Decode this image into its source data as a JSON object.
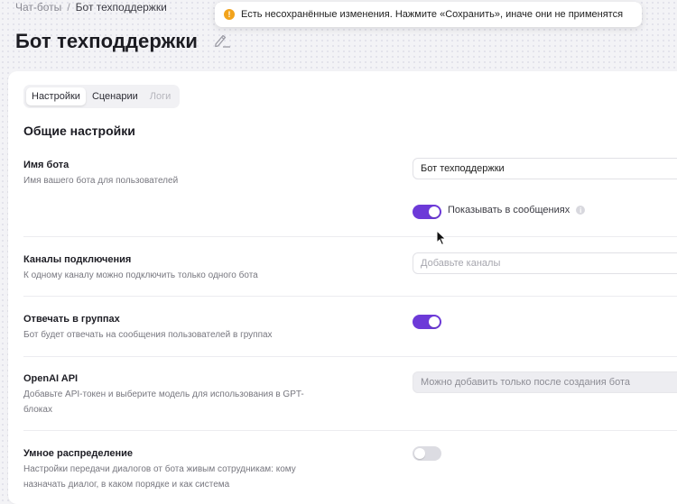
{
  "breadcrumb": {
    "root": "Чат-боты",
    "separator": "/",
    "current": "Бот техподдержки"
  },
  "page_title": "Бот техподдержки",
  "toast": {
    "icon": "warning-icon",
    "icon_glyph": "!",
    "text": "Есть несохранённые изменения. Нажмите «Сохранить», иначе они не применятся",
    "color": "#f2a31b"
  },
  "tabs": [
    {
      "label": "Настройки",
      "active": true
    },
    {
      "label": "Сценарии",
      "active": false
    },
    {
      "label": "Логи",
      "active": false,
      "disabled": true
    }
  ],
  "section_title": "Общие настройки",
  "settings": {
    "bot_name": {
      "label": "Имя бота",
      "description": "Имя вашего бота для пользователей",
      "value": "Бот техподдержки",
      "show_in_messages_label": "Показывать в сообщениях",
      "show_in_messages": true
    },
    "channels": {
      "label": "Каналы подключения",
      "description": "К одному каналу можно подключить только одного бота",
      "placeholder": "Добавьте каналы"
    },
    "groups": {
      "label": "Отвечать в группах",
      "description": "Бот будет отвечать на сообщения пользователей в группах",
      "enabled": true
    },
    "openai": {
      "label": "OpenAI API",
      "description": "Добавьте API-токен и выберите модель для использования в GPT-блоках",
      "disabled_text": "Можно добавить только после создания бота"
    },
    "smart_routing": {
      "label": "Умное распределение",
      "description": "Настройки передачи диалогов от бота живым сотрудникам: кому назначать диалог, в каком порядке и как система",
      "enabled": false
    }
  },
  "colors": {
    "accent": "#6d3ad8",
    "toggle_off": "#dcdce2"
  }
}
